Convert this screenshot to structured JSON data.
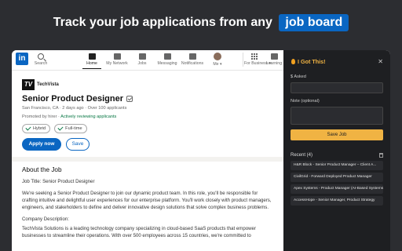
{
  "banner": {
    "text": "Track your job applications from any",
    "highlight": "job board"
  },
  "linkedin": {
    "logo": "in",
    "search_label": "Search",
    "nav": [
      {
        "label": "Home",
        "icon": "home-icon",
        "active": true
      },
      {
        "label": "My Network",
        "icon": "network-icon",
        "active": false
      },
      {
        "label": "Jobs",
        "icon": "jobs-icon",
        "active": false
      },
      {
        "label": "Messaging",
        "icon": "messaging-icon",
        "active": false
      },
      {
        "label": "Notifications",
        "icon": "bell-icon",
        "active": false
      },
      {
        "label": "Me ▾",
        "icon": "avatar",
        "active": false
      }
    ],
    "business_label": "For Business ▾",
    "learning_label": "Learning"
  },
  "job": {
    "company_logo": "TV",
    "company": "TechVista",
    "title": "Senior Product Designer",
    "meta": "San Francisco, CA · 2 days ago · Over 100 applicants",
    "promoted_prefix": "Promoted by hirer · ",
    "promoted_status": "Actively reviewing applicants",
    "pills": [
      "Hybrid",
      "Full-time"
    ],
    "apply_label": "Apply now",
    "save_label": "Save"
  },
  "about": {
    "heading": "About the Job",
    "job_title_line": "Job Title: Senior Product Designer",
    "para1": "We're seeking a Senior Product Designer to join our dynamic product team. In this role, you'll be responsible for crafting intuitive and delightful user experiences for our enterprise platform. You'll work closely with product managers, engineers, and stakeholders to define and deliver innovative design solutions that solve complex business problems.",
    "company_desc_label": "Company Description:",
    "para2": "TechVista Solutions is a leading technology company specializing in cloud-based SaaS products that empower businesses to streamline their operations. With over 500 employees across 15 countries, we're committed to"
  },
  "extension": {
    "title": "I Got This!",
    "asked_label": "$ Asked",
    "asked_value": "",
    "note_label": "Note (optional)",
    "note_value": "",
    "save_label": "Save Job",
    "recent_label": "Recent (4)",
    "recent": [
      "H&R Block - Senior Product Manager – Client A...",
      "CivilGrid - Forward Deployed Product Manager",
      "Apex Systems - Product Manager (AI-Based Systems)",
      "AccessHope - Senior Manager, Product Strategy"
    ],
    "accent": "#f0b343"
  }
}
